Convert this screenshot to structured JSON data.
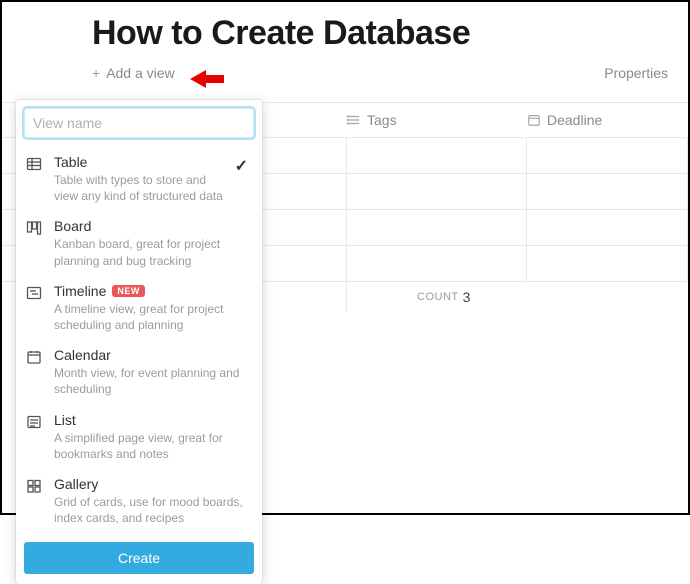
{
  "page": {
    "title": "How to Create Database"
  },
  "toolbar": {
    "add_view_label": "Add a view",
    "properties_label": "Properties"
  },
  "table": {
    "columns": {
      "tags": "Tags",
      "deadline": "Deadline"
    },
    "footer": {
      "count_label": "Count",
      "count_value": "3"
    }
  },
  "popover": {
    "input_placeholder": "View name",
    "create_label": "Create",
    "options": [
      {
        "title": "Table",
        "desc": "Table with types to store and view any kind of structured data",
        "selected": true
      },
      {
        "title": "Board",
        "desc": "Kanban board, great for project planning and bug tracking"
      },
      {
        "title": "Timeline",
        "desc": "A timeline view, great for project scheduling and planning",
        "badge": "NEW"
      },
      {
        "title": "Calendar",
        "desc": "Month view, for event planning and scheduling"
      },
      {
        "title": "List",
        "desc": "A simplified page view, great for bookmarks and notes"
      },
      {
        "title": "Gallery",
        "desc": "Grid of cards, use for mood boards, index cards, and recipes"
      }
    ]
  }
}
